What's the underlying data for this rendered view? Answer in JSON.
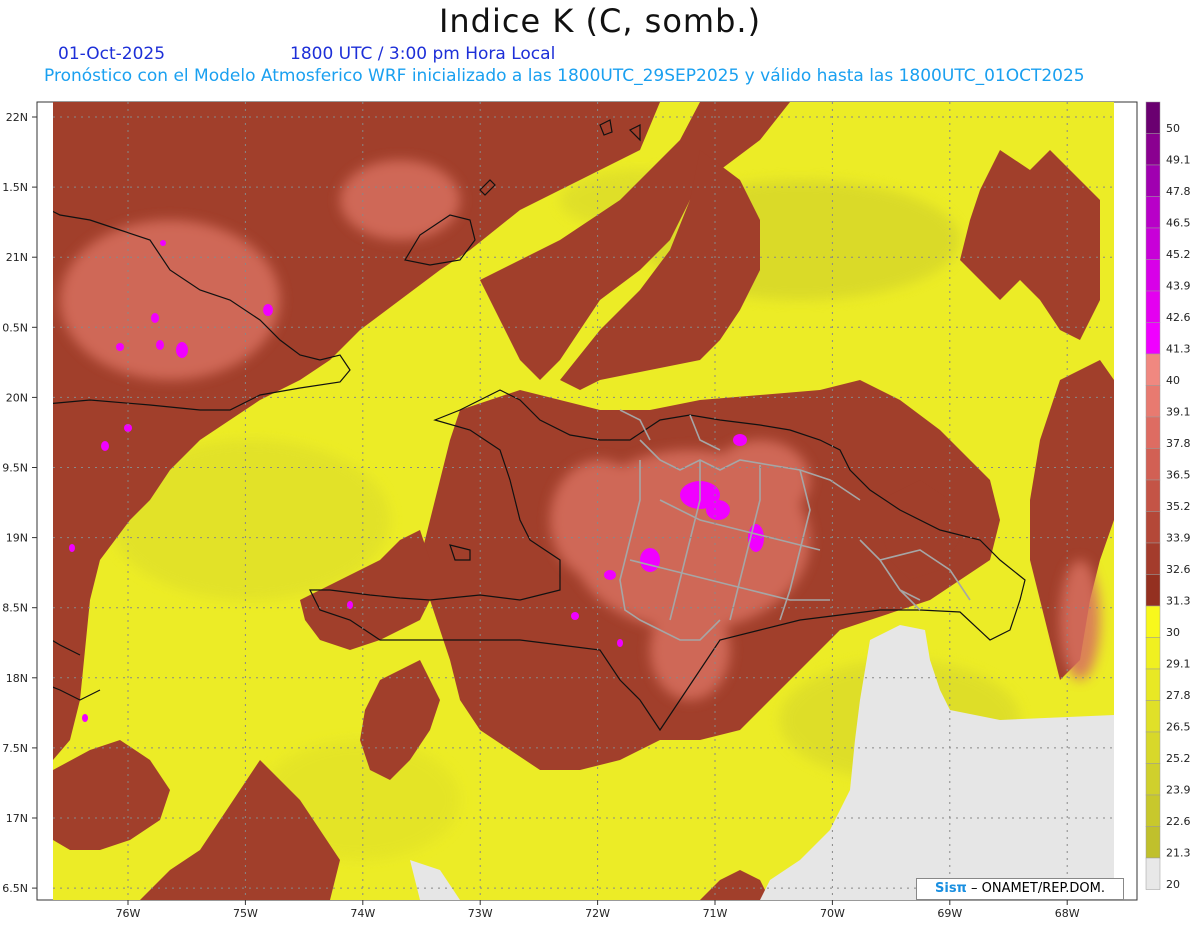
{
  "title": "Indice K (C, somb.)",
  "date_label": "01-Oct-2025",
  "time_label": "1800 UTC / 3:00 pm Hora Local",
  "subtitle": "Pronóstico con el Modelo Atmosferico WRF inicializado a las 1800UTC_29SEP2025 y válido hasta las  1800UTC_01OCT2025",
  "credit": {
    "logo": "Sisπ",
    "text": " – ONAMET/REP.DOM."
  },
  "map": {
    "lat_labels": [
      "22N",
      "1.5N",
      "21N",
      "0.5N",
      "20N",
      "9.5N",
      "19N",
      "8.5N",
      "18N",
      "7.5N",
      "17N",
      "6.5N"
    ],
    "lon_labels": [
      "76W",
      "75W",
      "74W",
      "73W",
      "72W",
      "71W",
      "70W",
      "69W",
      "68W"
    ],
    "lat_values": [
      22,
      21.5,
      21,
      20.5,
      20,
      19.5,
      19,
      18.5,
      18,
      17.5,
      17,
      16.5
    ],
    "lon_values": [
      -76,
      -75,
      -74,
      -73,
      -72,
      -71,
      -70,
      -69,
      -68
    ]
  },
  "colorbar": {
    "labels": [
      "50",
      "49.1",
      "47.8",
      "46.5",
      "45.2",
      "43.9",
      "42.6",
      "41.3",
      "40",
      "39.1",
      "37.8",
      "36.5",
      "35.2",
      "33.9",
      "32.6",
      "31.3",
      "30",
      "29.1",
      "27.8",
      "26.5",
      "25.2",
      "23.9",
      "22.6",
      "21.3",
      "20"
    ],
    "colors": [
      "#6a0070",
      "#8a0090",
      "#a000b0",
      "#b800c8",
      "#c800d8",
      "#d800e8",
      "#e400f0",
      "#f000ff",
      "#f08880",
      "#e87a70",
      "#de6c62",
      "#d26054",
      "#c45446",
      "#b44838",
      "#a43c2c",
      "#943020",
      "#f8f81c",
      "#f0f020",
      "#e8e824",
      "#e0e028",
      "#d8d82a",
      "#d0d02c",
      "#c8c82c",
      "#c0c02c",
      "#e8e8e8"
    ]
  },
  "colors": {
    "warm": "#9e3e2a",
    "yellow": "#eded26",
    "magenta": "#f000ff",
    "land_no_data": "#e6e6e6"
  }
}
